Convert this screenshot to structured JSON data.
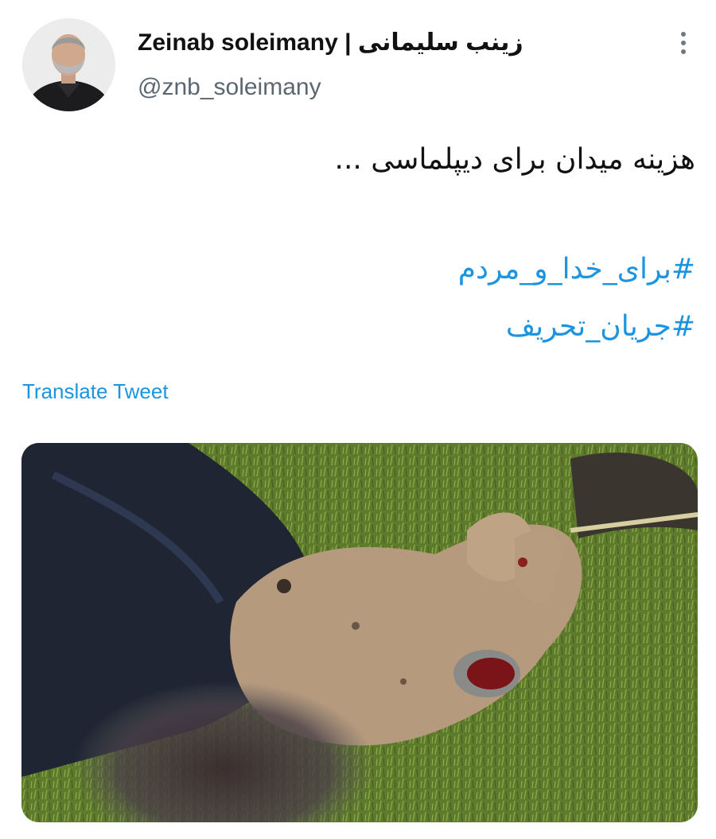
{
  "author": {
    "name": "Zeinab soleimany | زینب سلیمانی",
    "handle": "@znb_soleimany"
  },
  "tweet": {
    "text": "هزینه میدان برای دیپلماسی ...",
    "hashtags": [
      "#برای_خدا_و_مردم",
      "#جریان_تحریف"
    ]
  },
  "actions": {
    "translate_label": "Translate Tweet"
  },
  "icons": {
    "more": "more-vertical-icon"
  },
  "colors": {
    "link": "#1b95e0",
    "text": "#111111",
    "secondary": "#5b6770"
  }
}
